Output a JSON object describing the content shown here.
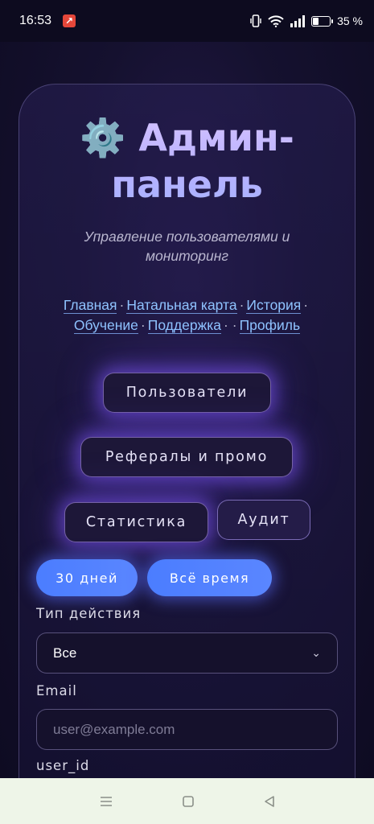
{
  "status": {
    "time": "16:53",
    "battery": "35 %",
    "battery_level": 0.35
  },
  "header": {
    "title_icon": "⚙️",
    "title_line1": "Админ-",
    "title_line2": "панель",
    "subtitle": "Управление пользователями и мониторинг"
  },
  "nav": {
    "items": [
      "Главная",
      "Натальная карта",
      "История",
      "Обучение",
      "Поддержка",
      "Профиль"
    ]
  },
  "sections": {
    "users": "Пользователи",
    "referrals": "Рефералы и промо",
    "stats": "Статистика",
    "audit": "Аудит"
  },
  "periods": {
    "days30": "30 дней",
    "all_time": "Всё время"
  },
  "filters": {
    "action_type_label": "Тип действия",
    "action_type_value": "Все",
    "email_label": "Email",
    "email_placeholder": "user@example.com",
    "user_id_label": "user_id"
  },
  "icons": {
    "app": "app-notification-icon",
    "vibrate": "vibrate-icon",
    "wifi": "wifi-icon",
    "signal": "signal-icon",
    "battery": "battery-icon",
    "gear": "gear-icon",
    "select": "chevron-down-icon",
    "menu": "menu-icon",
    "home": "home-icon",
    "back": "back-icon"
  },
  "colors": {
    "accent_blue": "#4b7dff",
    "title_lavender": "#c9b8ff",
    "link_blue": "#8fc3ff",
    "glow_purple": "#825aff"
  }
}
